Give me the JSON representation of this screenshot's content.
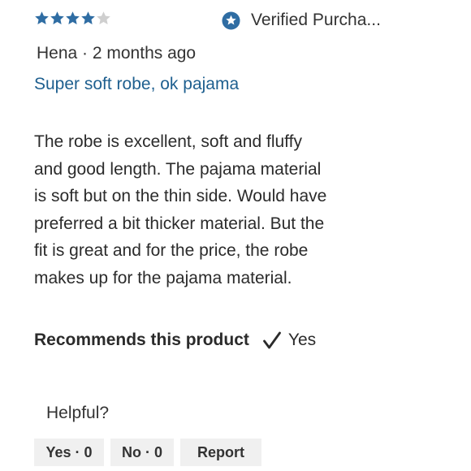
{
  "review": {
    "rating": 4,
    "max_rating": 5,
    "star_color": "#2f6da3",
    "star_empty_color": "#cfcfcf",
    "verified_label": "Verified Purcha...",
    "verified_icon": "badge-star-icon",
    "author_line": "Hena · 2 months ago",
    "title": "Super soft robe, ok pajama",
    "title_color": "#1e5f8f",
    "body_lines": [
      "The robe is excellent, soft and fluffy",
      "and good length. The pajama material",
      "is soft but on the thin side. Would have",
      "preferred a bit thicker material. But the",
      "fit is great and for the price, the robe",
      "makes up for the pajama material."
    ],
    "recommends_label": "Recommends this product",
    "recommends_icon": "checkmark-icon",
    "recommends_value": "Yes"
  },
  "feedback": {
    "prompt": "Helpful?",
    "yes_label": "Yes · 0",
    "no_label": "No · 0",
    "report_label": "Report"
  }
}
